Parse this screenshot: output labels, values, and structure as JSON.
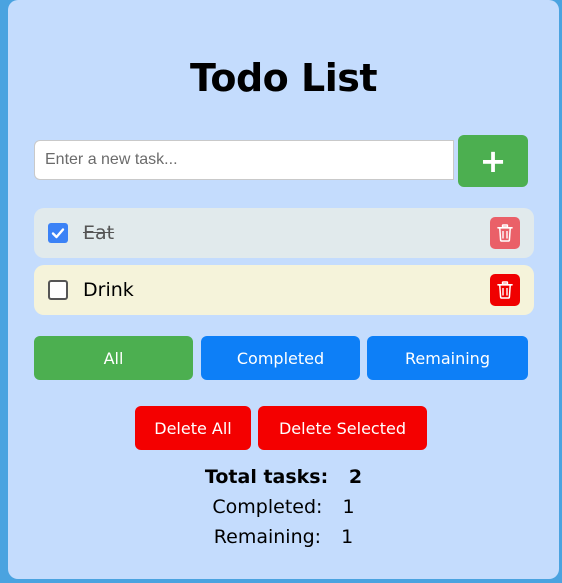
{
  "title": "Todo List",
  "input": {
    "placeholder": "Enter a new task...",
    "value": ""
  },
  "add_button": {
    "label": "+"
  },
  "tasks": [
    {
      "text": "Eat",
      "completed": true
    },
    {
      "text": "Drink",
      "completed": false
    }
  ],
  "filters": {
    "all": "All",
    "completed": "Completed",
    "remaining": "Remaining"
  },
  "actions": {
    "delete_all": "Delete All",
    "delete_selected": "Delete Selected"
  },
  "stats": {
    "total_label": "Total tasks:",
    "total": "2",
    "completed_label": "Completed:",
    "completed": "1",
    "remaining_label": "Remaining:",
    "remaining": "1"
  },
  "colors": {
    "background": "#c4dcfd",
    "add": "#4caf50",
    "filter_active": "#4caf50",
    "filter": "#0d7ff7",
    "danger": "#f40000",
    "checkbox": "#3b82f6"
  },
  "icons": {
    "add": "plus-icon",
    "delete": "trash-icon",
    "check": "checkmark-icon"
  }
}
